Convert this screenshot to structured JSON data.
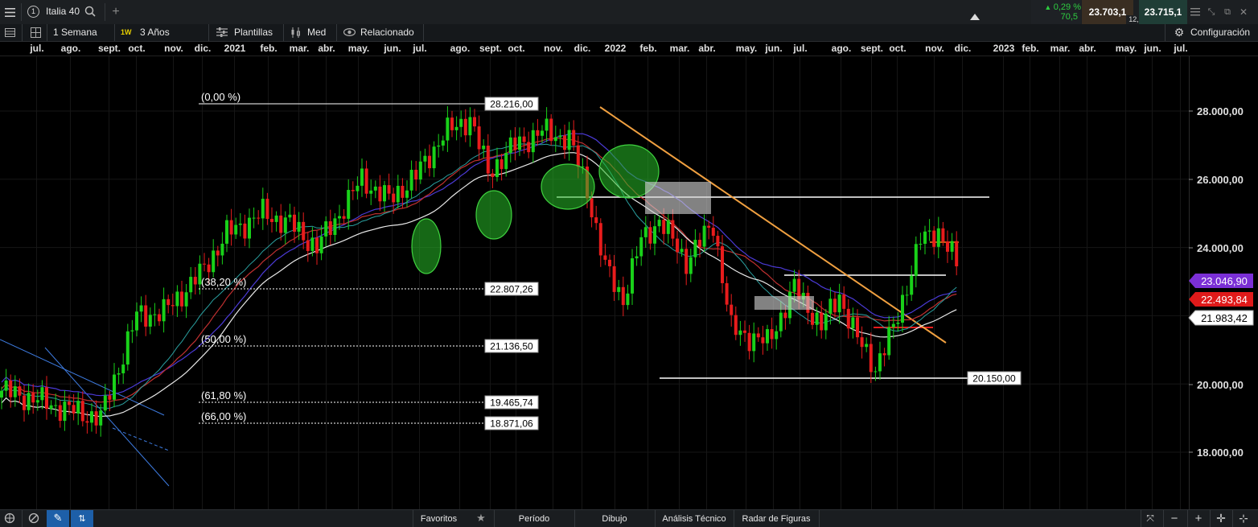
{
  "instrument": {
    "name": "Italia 40",
    "tab_number": "1",
    "add_tab": "+"
  },
  "quote": {
    "change_pct": "0,29 %",
    "change_abs": "70,5",
    "bid": "23.703,1",
    "spread": "12,0",
    "ask": "23.715,1"
  },
  "toolbar": {
    "interval": "1 Semana",
    "interval_badge": "1W",
    "range": "3 Años",
    "templates": "Plantillas",
    "price_type": "Med",
    "related": "Relacionado",
    "settings": "Configuración"
  },
  "time_axis": [
    "jul.",
    "ago.",
    "sept.",
    "oct.",
    "nov.",
    "dic.",
    "2021",
    "feb.",
    "mar.",
    "abr.",
    "may.",
    "jun.",
    "jul.",
    "ago.",
    "sept.",
    "oct.",
    "nov.",
    "dic.",
    "2022",
    "feb.",
    "mar.",
    "abr.",
    "may.",
    "jun.",
    "jul.",
    "ago.",
    "sept.",
    "oct.",
    "nov.",
    "dic.",
    "2023",
    "feb.",
    "mar.",
    "abr.",
    "may.",
    "jun.",
    "jul."
  ],
  "price_axis": {
    "ticks": [
      "28.000,00",
      "26.000,00",
      "24.000,00",
      "20.000,00",
      "18.000,00"
    ],
    "ma_labels": [
      {
        "text": "23.046,90",
        "color": "#7b2fd6"
      },
      {
        "text": "22.493,84",
        "color": "#e01a1a"
      },
      {
        "text": "21.983,42",
        "color": "#ffffff"
      }
    ]
  },
  "fibonacci": [
    {
      "pct": "(0,00 %)",
      "price": "28.216,00"
    },
    {
      "pct": "(38,20 %)",
      "price": "22.807,26"
    },
    {
      "pct": "(50,00 %)",
      "price": "21.136,50"
    },
    {
      "pct": "(61,80 %)",
      "price": "19.465,74"
    },
    {
      "pct": "(66,00 %)",
      "price": "18.871,06"
    }
  ],
  "annotations": {
    "support_label": "20.150,00"
  },
  "bottom_bar": {
    "favorites": "Favoritos",
    "period": "Período",
    "drawing": "Dibujo",
    "technical": "Análisis Técnico",
    "patterns": "Radar de Figuras"
  },
  "chart_data": {
    "type": "candlestick",
    "interval": "1W",
    "ylim": [
      16500,
      29500
    ],
    "x": [
      "jul.",
      "ago.",
      "sept.",
      "oct.",
      "nov.",
      "dic.",
      "2021",
      "feb.",
      "mar.",
      "abr.",
      "may.",
      "jun.",
      "jul.",
      "ago.",
      "sept.",
      "oct.",
      "nov.",
      "dic.",
      "2022",
      "feb.",
      "mar.",
      "abr.",
      "may.",
      "jun.",
      "jul.",
      "ago.",
      "sept.",
      "oct.",
      "nov.",
      "dic."
    ],
    "close_approx": [
      19800,
      19700,
      19400,
      19200,
      21500,
      22100,
      22000,
      22800,
      23600,
      24500,
      24900,
      25000,
      24400,
      26000,
      25500,
      26300,
      27400,
      26700,
      27200,
      26300,
      24300,
      24700,
      24200,
      22400,
      21400,
      22800,
      22200,
      20800,
      23700,
      23700
    ],
    "series": [
      {
        "name": "",
        "color": "#7b2fd6",
        "last": 23046.9
      },
      {
        "name": "",
        "color": "#e01a1a",
        "last": 22493.84
      },
      {
        "name": "",
        "color": "#ffffff",
        "last": 21983.42
      }
    ],
    "grid": true
  }
}
